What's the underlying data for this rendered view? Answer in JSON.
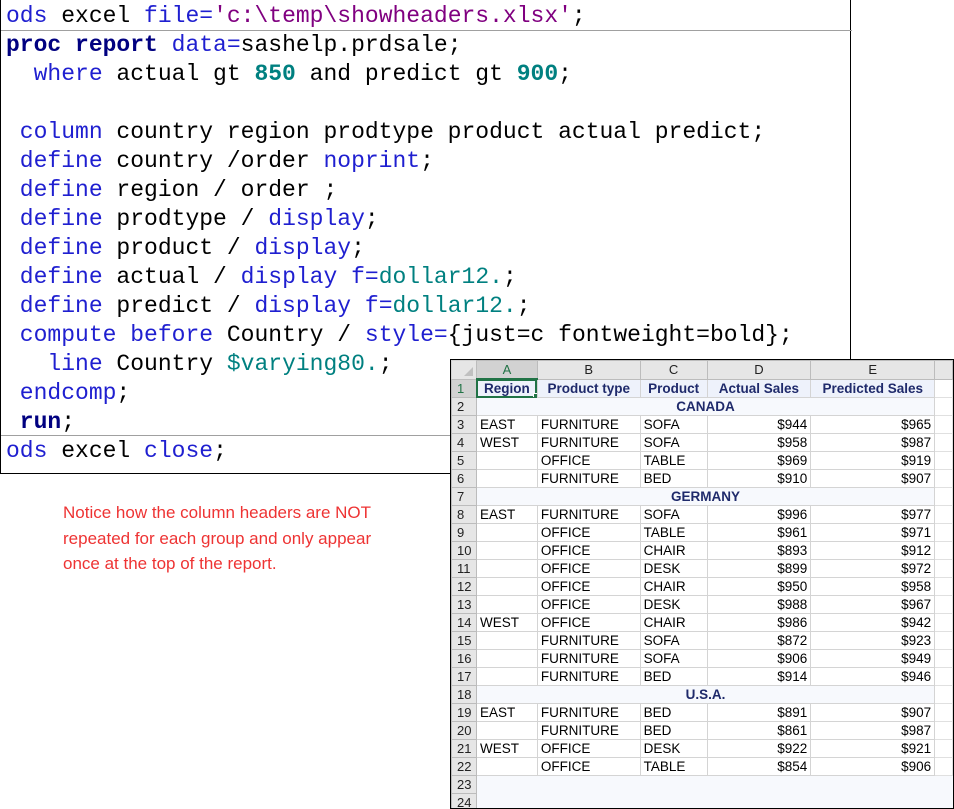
{
  "code": {
    "lines": [
      [
        {
          "t": "ods",
          "c": "kw"
        },
        {
          "t": " excel ",
          "c": "txt"
        },
        {
          "t": "file=",
          "c": "kw"
        },
        {
          "t": "'c:\\temp\\showheaders.xlsx'",
          "c": "str"
        },
        {
          "t": ";",
          "c": "txt"
        }
      ],
      [
        {
          "t": "proc report",
          "c": "kwb"
        },
        {
          "t": " ",
          "c": "txt"
        },
        {
          "t": "data=",
          "c": "kw"
        },
        {
          "t": "sashelp.prdsale;",
          "c": "txt"
        }
      ],
      [
        {
          "t": "  where",
          "c": "kw"
        },
        {
          "t": " actual gt ",
          "c": "txt"
        },
        {
          "t": "850",
          "c": "num"
        },
        {
          "t": " and predict gt ",
          "c": "txt"
        },
        {
          "t": "900",
          "c": "num"
        },
        {
          "t": ";",
          "c": "txt"
        }
      ],
      [],
      [
        {
          "t": " column",
          "c": "kw"
        },
        {
          "t": " country region prodtype product actual predict;",
          "c": "txt"
        }
      ],
      [
        {
          "t": " define",
          "c": "kw"
        },
        {
          "t": " country /order ",
          "c": "txt"
        },
        {
          "t": "noprint",
          "c": "kw"
        },
        {
          "t": ";",
          "c": "txt"
        }
      ],
      [
        {
          "t": " define",
          "c": "kw"
        },
        {
          "t": " region / order ;",
          "c": "txt"
        }
      ],
      [
        {
          "t": " define",
          "c": "kw"
        },
        {
          "t": " prodtype / ",
          "c": "txt"
        },
        {
          "t": "display",
          "c": "kw"
        },
        {
          "t": ";",
          "c": "txt"
        }
      ],
      [
        {
          "t": " define",
          "c": "kw"
        },
        {
          "t": " product / ",
          "c": "txt"
        },
        {
          "t": "display",
          "c": "kw"
        },
        {
          "t": ";",
          "c": "txt"
        }
      ],
      [
        {
          "t": " define",
          "c": "kw"
        },
        {
          "t": " actual / ",
          "c": "txt"
        },
        {
          "t": "display",
          "c": "kw"
        },
        {
          "t": " ",
          "c": "txt"
        },
        {
          "t": "f=",
          "c": "kw"
        },
        {
          "t": "dollar12.",
          "c": "fmt"
        },
        {
          "t": ";",
          "c": "txt"
        }
      ],
      [
        {
          "t": " define",
          "c": "kw"
        },
        {
          "t": " predict / ",
          "c": "txt"
        },
        {
          "t": "display",
          "c": "kw"
        },
        {
          "t": " ",
          "c": "txt"
        },
        {
          "t": "f=",
          "c": "kw"
        },
        {
          "t": "dollar12.",
          "c": "fmt"
        },
        {
          "t": ";",
          "c": "txt"
        }
      ],
      [
        {
          "t": " compute",
          "c": "kw"
        },
        {
          "t": " ",
          "c": "txt"
        },
        {
          "t": "before",
          "c": "kw"
        },
        {
          "t": " Country / ",
          "c": "txt"
        },
        {
          "t": "style=",
          "c": "kw"
        },
        {
          "t": "{just=c fontweight=bold};",
          "c": "txt"
        }
      ],
      [
        {
          "t": "   line",
          "c": "kw"
        },
        {
          "t": " Country ",
          "c": "txt"
        },
        {
          "t": "$varying80.",
          "c": "fmt"
        },
        {
          "t": ";",
          "c": "txt"
        }
      ],
      [
        {
          "t": " endcomp",
          "c": "kw"
        },
        {
          "t": ";",
          "c": "txt"
        }
      ],
      [
        {
          "t": " run",
          "c": "kwb"
        },
        {
          "t": ";",
          "c": "txt"
        }
      ],
      [
        {
          "t": "ods",
          "c": "kw"
        },
        {
          "t": " excel ",
          "c": "txt"
        },
        {
          "t": "close",
          "c": "kw"
        },
        {
          "t": ";",
          "c": "txt"
        }
      ]
    ]
  },
  "note": "Notice how the column headers are NOT repeated for each group and only appear once at the top of the report.",
  "sheet": {
    "column_letters": [
      "A",
      "B",
      "C",
      "D",
      "E"
    ],
    "active_column": "A",
    "headers": [
      "Region",
      "Product type",
      "Product",
      "Actual Sales",
      "Predicted Sales"
    ],
    "rows": [
      {
        "n": "2",
        "group": "CANADA"
      },
      {
        "n": "3",
        "cells": [
          "EAST",
          "FURNITURE",
          "SOFA",
          "$944",
          "$965"
        ]
      },
      {
        "n": "4",
        "cells": [
          "WEST",
          "FURNITURE",
          "SOFA",
          "$958",
          "$987"
        ]
      },
      {
        "n": "5",
        "cells": [
          "",
          "OFFICE",
          "TABLE",
          "$969",
          "$919"
        ]
      },
      {
        "n": "6",
        "cells": [
          "",
          "FURNITURE",
          "BED",
          "$910",
          "$907"
        ]
      },
      {
        "n": "7",
        "group": "GERMANY"
      },
      {
        "n": "8",
        "cells": [
          "EAST",
          "FURNITURE",
          "SOFA",
          "$996",
          "$977"
        ]
      },
      {
        "n": "9",
        "cells": [
          "",
          "OFFICE",
          "TABLE",
          "$961",
          "$971"
        ]
      },
      {
        "n": "10",
        "cells": [
          "",
          "OFFICE",
          "CHAIR",
          "$893",
          "$912"
        ]
      },
      {
        "n": "11",
        "cells": [
          "",
          "OFFICE",
          "DESK",
          "$899",
          "$972"
        ]
      },
      {
        "n": "12",
        "cells": [
          "",
          "OFFICE",
          "CHAIR",
          "$950",
          "$958"
        ]
      },
      {
        "n": "13",
        "cells": [
          "",
          "OFFICE",
          "DESK",
          "$988",
          "$967"
        ]
      },
      {
        "n": "14",
        "cells": [
          "WEST",
          "OFFICE",
          "CHAIR",
          "$986",
          "$942"
        ]
      },
      {
        "n": "15",
        "cells": [
          "",
          "FURNITURE",
          "SOFA",
          "$872",
          "$923"
        ]
      },
      {
        "n": "16",
        "cells": [
          "",
          "FURNITURE",
          "SOFA",
          "$906",
          "$949"
        ]
      },
      {
        "n": "17",
        "cells": [
          "",
          "FURNITURE",
          "BED",
          "$914",
          "$946"
        ]
      },
      {
        "n": "18",
        "group": "U.S.A."
      },
      {
        "n": "19",
        "cells": [
          "EAST",
          "FURNITURE",
          "BED",
          "$891",
          "$907"
        ]
      },
      {
        "n": "20",
        "cells": [
          "",
          "FURNITURE",
          "BED",
          "$861",
          "$987"
        ]
      },
      {
        "n": "21",
        "cells": [
          "WEST",
          "OFFICE",
          "DESK",
          "$922",
          "$921"
        ]
      },
      {
        "n": "22",
        "cells": [
          "",
          "OFFICE",
          "TABLE",
          "$854",
          "$906"
        ]
      },
      {
        "n": "23",
        "empty": true
      },
      {
        "n": "24",
        "empty": true
      }
    ]
  }
}
